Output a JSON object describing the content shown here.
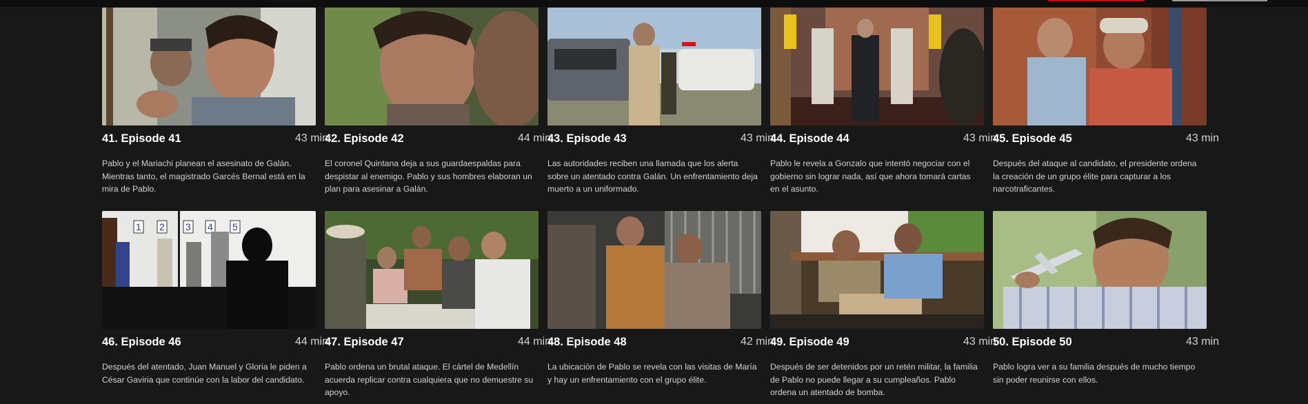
{
  "episodes": [
    {
      "number": "41.",
      "title": "Episode 41",
      "duration": "43 min",
      "description": "Pablo y el Mariachi planean el asesinato de Galán. Mientras tanto, el magistrado Garcés Bernal está en la mira de Pablo."
    },
    {
      "number": "42.",
      "title": "Episode 42",
      "duration": "44 min",
      "description": "El coronel Quintana deja a sus guardaespaldas para despistar al enemigo. Pablo y sus hombres elaboran un plan para asesinar a Galán."
    },
    {
      "number": "43.",
      "title": "Episode 43",
      "duration": "43 min",
      "description": "Las autoridades reciben una llamada que los alerta sobre un atentado contra Galán. Un enfrentamiento deja muerto a un uniformado."
    },
    {
      "number": "44.",
      "title": "Episode 44",
      "duration": "43 min",
      "description": "Pablo le revela a Gonzalo que intentó negociar con el gobierno sin lograr nada, así que ahora tomará cartas en el asunto."
    },
    {
      "number": "45.",
      "title": "Episode 45",
      "duration": "43 min",
      "description": "Después del ataque al candidato, el presidente ordena la creación de un grupo élite para capturar a los narcotraficantes."
    },
    {
      "number": "46.",
      "title": "Episode 46",
      "duration": "44 min",
      "description": "Después del atentado, Juan Manuel y Gloria le piden a César Gaviria que continúe con la labor del candidato."
    },
    {
      "number": "47.",
      "title": "Episode 47",
      "duration": "44 min",
      "description": "Pablo ordena un brutal ataque. El cártel de Medellín acuerda replicar contra cualquiera que no demuestre su apoyo."
    },
    {
      "number": "48.",
      "title": "Episode 48",
      "duration": "42 min",
      "description": "La ubicación de Pablo se revela con las visitas de María y hay un enfrentamiento con el grupo élite."
    },
    {
      "number": "49.",
      "title": "Episode 49",
      "duration": "43 min",
      "description": "Después de ser detenidos por un retén militar, la familia de Pablo no puede llegar a su cumpleaños. Pablo ordena un atentado de bomba."
    },
    {
      "number": "50.",
      "title": "Episode 50",
      "duration": "43 min",
      "description": "Pablo logra ver a su familia después de mucho tiempo sin poder reunirse con ellos."
    }
  ],
  "lineup_numbers": [
    "1",
    "2",
    "3",
    "4",
    "5"
  ]
}
